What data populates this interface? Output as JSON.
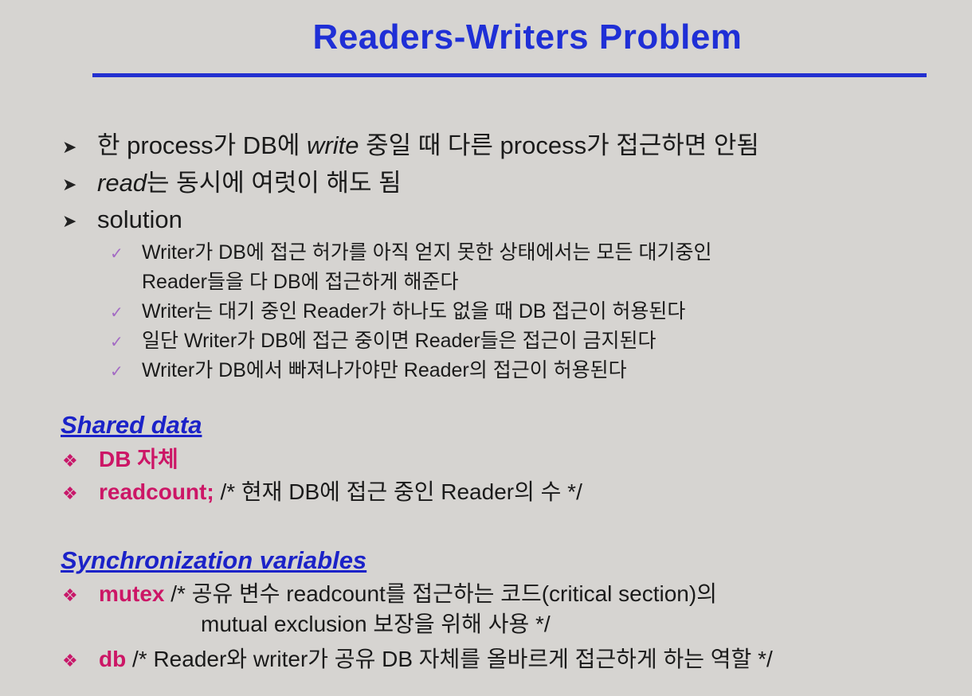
{
  "title": "Readers-Writers Problem",
  "bullets": {
    "b1_pre": "한 process가 DB에 ",
    "b1_em": "write",
    "b1_post": " 중일 때 다른 process가 접근하면 안됨",
    "b2_em": "read",
    "b2_post": "는 동시에 여럿이 해도 됨",
    "b3": "solution"
  },
  "subs": {
    "s1_line1": "Writer가 DB에 접근 허가를 아직 얻지 못한 상태에서는 모든 대기중인",
    "s1_line2": "Reader들을 다 DB에 접근하게 해준다",
    "s2": "Writer는 대기 중인 Reader가 하나도 없을 때 DB 접근이 허용된다",
    "s3": "일단 Writer가 DB에 접근 중이면 Reader들은 접근이 금지된다",
    "s4": "Writer가 DB에서 빠져나가야만 Reader의 접근이 허용된다"
  },
  "shared": {
    "heading": "Shared data",
    "item1_kw": "DB 자체",
    "item2_kw": "readcount;",
    "item2_comment": " /* 현재 DB에 접근 중인 Reader의 수 */"
  },
  "sync": {
    "heading": "Synchronization variables",
    "item1_kw": "mutex",
    "item1_comment": " /* 공유 변수 readcount를 접근하는 코드(critical section)의",
    "item1_cont": "mutual exclusion 보장을 위해 사용 */",
    "item2_kw": "db",
    "item2_comment": "  /* Reader와 writer가 공유 DB 자체를 올바르게 접근하게 하는 역할 */"
  },
  "icons": {
    "bullet": "arrow-bullet-icon",
    "sub": "checkmark-icon",
    "code": "diamond-bullet-icon"
  },
  "colors": {
    "title": "#1f2fd6",
    "rule": "#2330d0",
    "heading": "#1b22c8",
    "keyword": "#cc1666",
    "check": "#a36ac4",
    "background": "#d6d4d1"
  }
}
